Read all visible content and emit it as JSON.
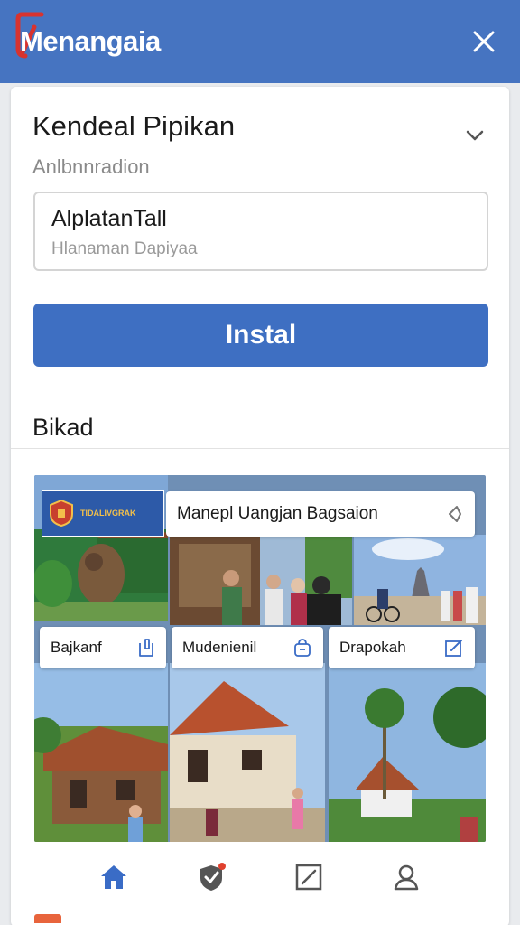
{
  "app": {
    "title": "Menangaia"
  },
  "header": {
    "title": "Kendeal Pipikan",
    "subtitle": "Anlbnnradion"
  },
  "input": {
    "value": "AlplatanTall",
    "hint": "Hlanaman Dapiyaa"
  },
  "install_button": {
    "label": "Instal"
  },
  "section": {
    "title": "Bikad"
  },
  "gallery": {
    "banner_text": "TIDALIVGRAK",
    "featured_label": "Manepl Uangjan Bagsaion",
    "items": [
      {
        "label": "Bajkanf"
      },
      {
        "label": "Mudenienil"
      },
      {
        "label": "Drapokah"
      }
    ]
  },
  "colors": {
    "topbar": "#4674c1",
    "primary_button": "#3e6fc2",
    "icon_blue": "#3a6cc6"
  },
  "nav": {
    "items": [
      {
        "icon": "home-icon",
        "active": true
      },
      {
        "icon": "shield-check-icon",
        "active": false
      },
      {
        "icon": "edit-square-icon",
        "active": false
      },
      {
        "icon": "user-icon",
        "active": false
      }
    ]
  }
}
